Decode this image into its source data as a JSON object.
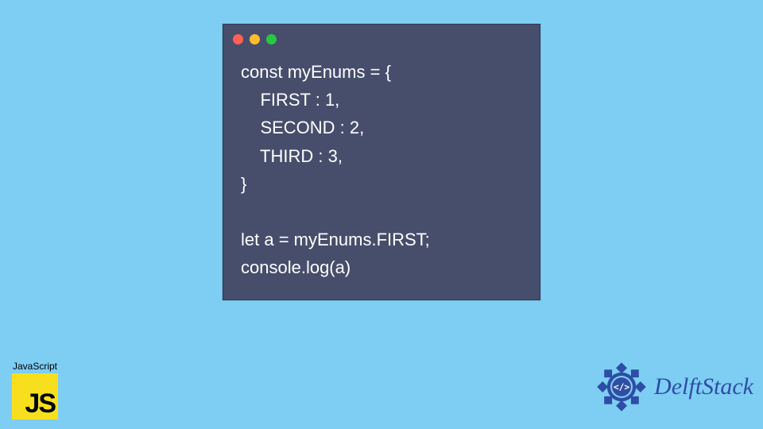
{
  "code_window": {
    "lines": [
      "const myEnums = {",
      "    FIRST : 1,",
      "    SECOND : 2,",
      "    THIRD : 3,",
      "}",
      "",
      "let a = myEnums.FIRST;",
      "console.log(a)"
    ]
  },
  "js_badge": {
    "label": "JavaScript",
    "logo_text": "JS"
  },
  "delftstack": {
    "text": "DelftStack"
  },
  "colors": {
    "background": "#7ecef4",
    "window_bg": "#474e6c",
    "dot_red": "#ff5f56",
    "dot_yellow": "#ffbd2e",
    "dot_green": "#27c93f",
    "js_yellow": "#f7df1e",
    "delft_blue": "#2e4da6"
  }
}
